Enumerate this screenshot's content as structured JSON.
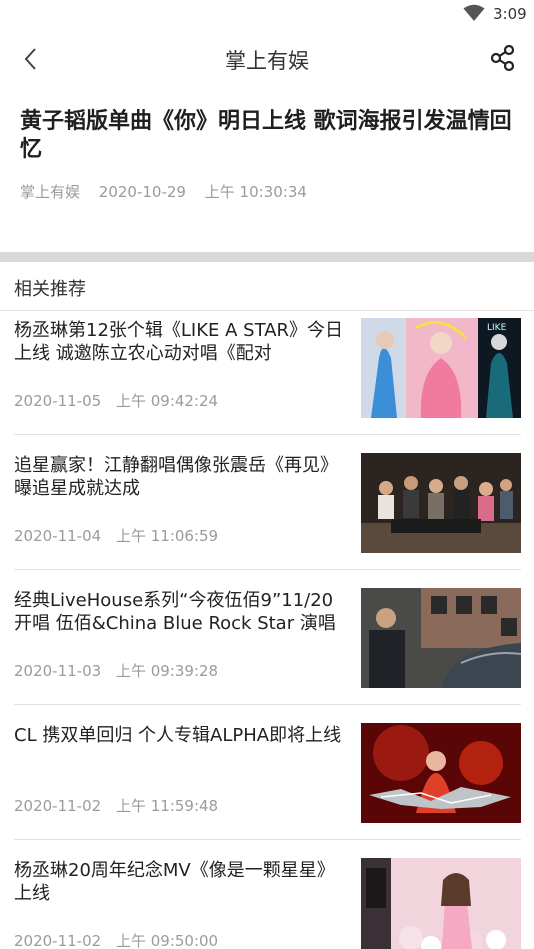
{
  "status_bar": {
    "time": "3:09",
    "wifi_icon": "wifi-icon"
  },
  "app_bar": {
    "title": "掌上有娱",
    "back_icon": "back-chevron-icon",
    "share_icon": "share-icon"
  },
  "article": {
    "title": "黄子韬版单曲《你》明日上线 歌词海报引发温情回忆",
    "source": "掌上有娱",
    "date": "2020-10-29",
    "time": "上午 10:30:34"
  },
  "related": {
    "section_title": "相关推荐",
    "items": [
      {
        "headline": "杨丞琳第12张个辑《LIKE A STAR》今日上线 诚邀陈立农心动对唱《配对",
        "date": "2020-11-05",
        "time": "上午 09:42:24"
      },
      {
        "headline": "追星赢家！江静翻唱偶像张震岳《再见》曝追星成就达成",
        "date": "2020-11-04",
        "time": "上午 11:06:59"
      },
      {
        "headline": "经典LiveHouse系列“今夜伍佰9”11/20开唱 伍佰&China Blue Rock Star 演唱",
        "date": "2020-11-03",
        "time": "上午 09:39:28"
      },
      {
        "headline": "CL 携双单回归 个人专辑ALPHA即将上线",
        "date": "2020-11-02",
        "time": "上午 11:59:48"
      },
      {
        "headline": "杨丞琳20周年纪念MV《像是一颗星星》上线",
        "date": "2020-11-02",
        "time": "上午 09:50:00"
      }
    ]
  }
}
